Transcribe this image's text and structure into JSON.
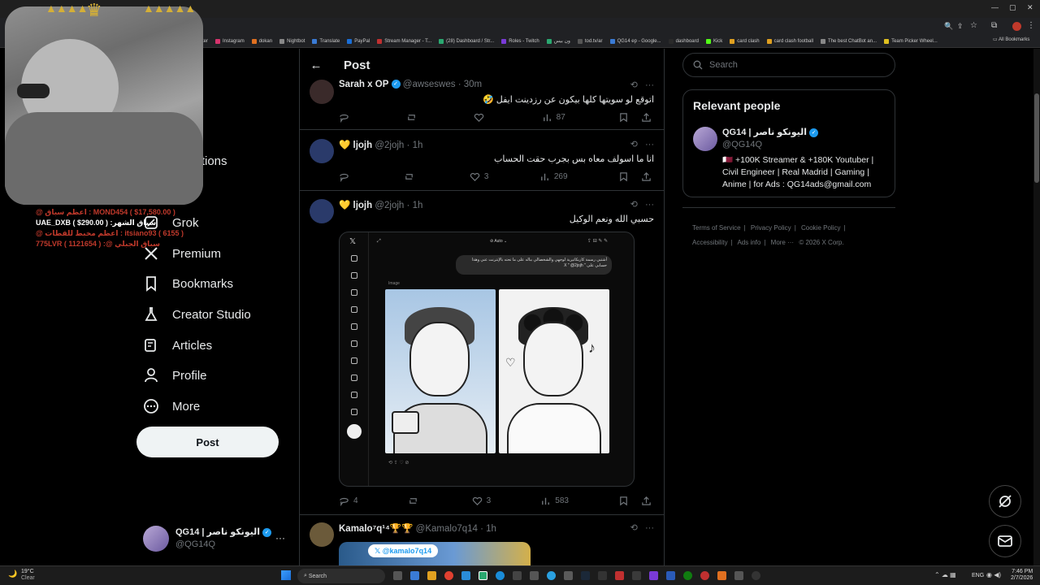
{
  "browser": {
    "bookmarks": [
      "ter",
      "Instagram",
      "dokan",
      "Nightbot",
      "Translate",
      "PayPal",
      "Stream Manager - T...",
      "(28) Dashboard / Str...",
      "Roles - Twitch",
      "ون بيس",
      "tod.tv/ar",
      "QG14 ep - Google...",
      "dashboard",
      "Kick",
      "card clash",
      "card clash football",
      "The best ChatBot an...",
      "Team Picker Wheel..."
    ],
    "all_bookmarks": "All Bookmarks"
  },
  "overlay": {
    "donations": [
      {
        "text": "@ اعظم سباق : MOND454 ( $17,580.00 )",
        "color": "#c0392b"
      },
      {
        "text": "UAE_DXB ( $290.00 ) :سباق الشهر",
        "color": "#ffffff"
      },
      {
        "text": "@ اعظم مخبط للقطات : itsiano93 ( 6155 )",
        "color": "#c0392b"
      },
      {
        "text": "775LVR ( 1121654 ) :@ سباق الجبلي",
        "color": "#c0392b"
      }
    ]
  },
  "nav": {
    "partial_items": [
      "re",
      "re",
      "cations"
    ],
    "items": [
      "Grok",
      "Premium",
      "Bookmarks",
      "Creator Studio",
      "Articles",
      "Profile",
      "More"
    ],
    "post_button": "Post"
  },
  "account": {
    "name": "QG14 | اليونكو ناصر",
    "handle": "@QG14Q",
    "more": "···"
  },
  "header": {
    "title": "Post",
    "back": "←"
  },
  "tweets": [
    {
      "name": "Sarah x OP",
      "handle": "@awseswes",
      "time": "· 30m",
      "text": "اتوقع لو سويتها كلها بيكون عن رزدينت ايفل 🤣",
      "reply": "",
      "repost": "",
      "like": "",
      "views": "87"
    },
    {
      "name": "💛 ljojh",
      "handle": "@2jojh",
      "time": "· 1h",
      "text": "انا ما اسولف معاه بس بجرب حقت الحساب",
      "reply": "",
      "repost": "",
      "like": "3",
      "views": "269"
    },
    {
      "name": "💛 ljojh",
      "handle": "@2jojh",
      "time": "· 1h",
      "text": "حسبي الله ونعم الوكيل",
      "reply": "4",
      "repost": "",
      "like": "3",
      "views": "583"
    },
    {
      "name": "Kamalo⁷q¹⁴🏆🏆",
      "handle": "@Kamalo7q14",
      "time": "· 1h",
      "text": "",
      "reply": "",
      "repost": "",
      "like": "",
      "views": ""
    }
  ],
  "embed": {
    "toolbar_label": "Auto",
    "bubble_text": "أشتبي رسمة كاريكاتيرية لوجهي والشخصالي بباله على ما تحته بالإنترنت عني وهذا حسابي على \" X \" @2jojh",
    "image_label": "Image",
    "card_handle": "@kamalo7q14"
  },
  "right": {
    "search_placeholder": "Search",
    "relevant_title": "Relevant people",
    "person": {
      "name": "QG14 | اليونكو ناصر",
      "handle": "@QG14Q",
      "bio": "🇶🇦 +100K Streamer & +180K Youtuber | Civil Engineer | Real Madrid | Gaming | Anime | for Ads : QG14ads@gmail.com"
    },
    "footer": [
      "Terms of Service",
      "|",
      "Privacy Policy",
      "|",
      "Cookie Policy",
      "|",
      "Accessibility",
      "|",
      "Ads info",
      "|",
      "More ···",
      "© 2026 X Corp."
    ]
  },
  "taskbar": {
    "weather_temp": "19°C",
    "weather_text": "Clear",
    "search": "Search",
    "lang": "ENG",
    "time": "7:46 PM",
    "date": "2/7/2026"
  }
}
